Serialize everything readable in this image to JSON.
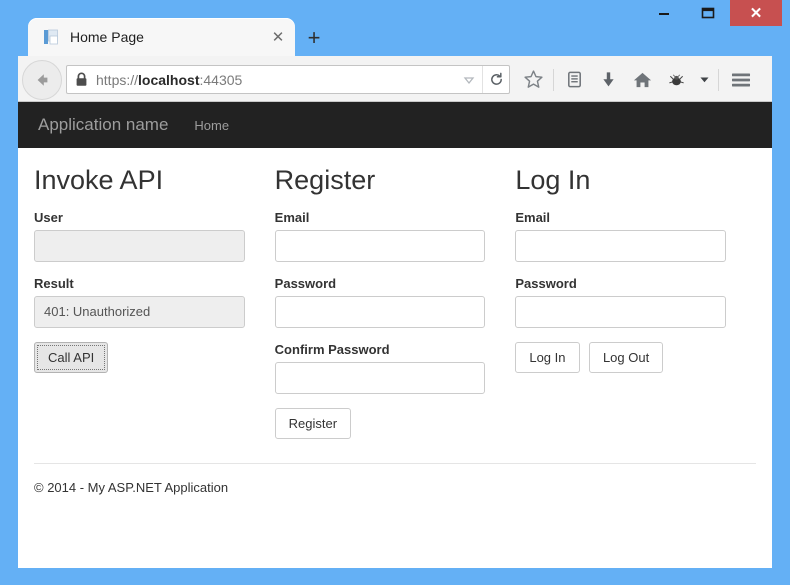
{
  "window": {
    "controls": {
      "minimize": "minimize-button",
      "maximize": "maximize-button",
      "close_glyph": "✕"
    }
  },
  "browser": {
    "tab": {
      "title": "Home Page",
      "close_glyph": "✕",
      "favicon": "document-favicon"
    },
    "newtab_glyph": "+",
    "urlbar": {
      "scheme": "https://",
      "host": "localhost",
      "port": ":44305",
      "full_url": "https://localhost:44305",
      "lock": "padlock-icon",
      "history_dropdown": "history-dropdown-icon",
      "reload": "reload-icon"
    },
    "toolbar_icons": [
      "bookmark-star-icon",
      "reader-list-icon",
      "downloads-icon",
      "home-icon",
      "firebug-bug-icon",
      "chevron-down-icon",
      "hamburger-menu-icon"
    ],
    "back_button": "back-icon"
  },
  "site": {
    "brand": "Application name",
    "navlinks": [
      {
        "label": "Home"
      }
    ]
  },
  "columns": {
    "invoke_api": {
      "title": "Invoke API",
      "user_label": "User",
      "user_value": "",
      "user_placeholder": "",
      "result_label": "Result",
      "result_value": "401: Unauthorized",
      "button": "Call API"
    },
    "register": {
      "title": "Register",
      "email_label": "Email",
      "email_value": "",
      "email_placeholder": "",
      "password_label": "Password",
      "password_value": "",
      "password_placeholder": "",
      "confirm_label": "Confirm Password",
      "confirm_value": "",
      "confirm_placeholder": "",
      "button": "Register"
    },
    "login": {
      "title": "Log In",
      "email_label": "Email",
      "email_value": "",
      "email_placeholder": "",
      "password_label": "Password",
      "password_value": "",
      "password_placeholder": "",
      "login_button": "Log In",
      "logout_button": "Log Out"
    }
  },
  "footer": {
    "text": "© 2014 - My ASP.NET Application"
  },
  "colors": {
    "window_frame": "#64b0f5",
    "close_button": "#c75050",
    "site_navbar": "#222222",
    "navbar_text": "#9d9d9d",
    "disabled_field": "#eeeeee",
    "field_border": "#cccccc"
  }
}
